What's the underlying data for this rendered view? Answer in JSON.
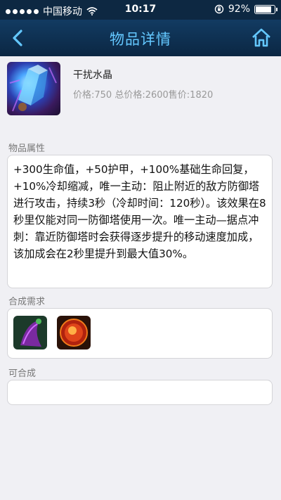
{
  "status": {
    "carrier": "中国移动",
    "time": "10:17",
    "battery": "92%",
    "battery_level": 0.92
  },
  "nav": {
    "title": "物品详情",
    "back_icon": "chevron-left-icon",
    "home_icon": "home-icon"
  },
  "item": {
    "name": "干扰水晶",
    "prices": "价格:750 总价格:2600售价:1820"
  },
  "sections": {
    "attributes": "物品属性",
    "recipe": "合成需求",
    "builds_into": "可合成"
  },
  "description": "+300生命值，+50护甲，+100%基础生命回复，+10%冷却缩减，唯一主动：阻止附近的敌方防御塔进行攻击，持续3秒（冷却时间：120秒）。该效果在8秒里仅能对同一防御塔使用一次。唯一主动—据点冲刺：靠近防御塔时会获得逐步提升的移动速度加成，该加成会在2秒里提升到最大值30%。",
  "colors": {
    "nav_bg": "#0b2743",
    "accent": "#64c8ff",
    "page_bg": "#f0f0f4"
  }
}
